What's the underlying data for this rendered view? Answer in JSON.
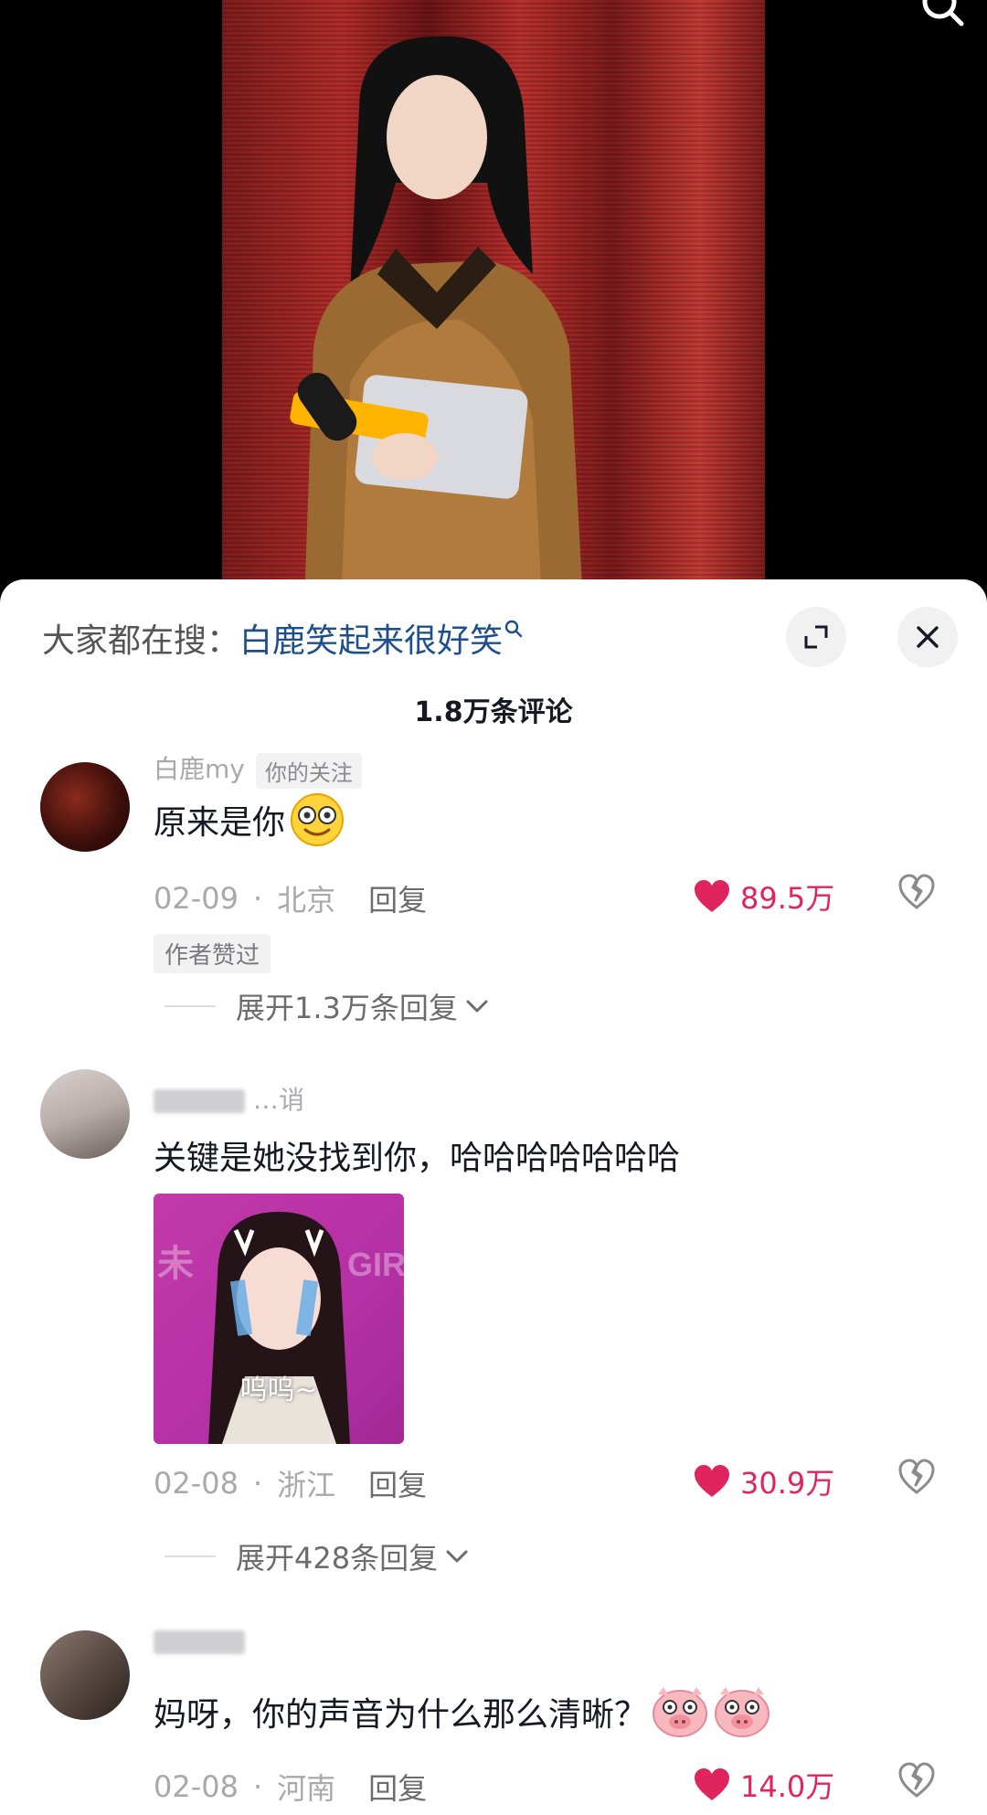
{
  "sheet": {
    "hot_search_prefix": "大家都在搜：",
    "hot_search_term": "白鹿笑起来很好笑",
    "comment_count": "1.8万条评论"
  },
  "comments": [
    {
      "username": "白鹿my",
      "follow_tag": "你的关注",
      "text": "原来是你",
      "date": "02-09",
      "location": "北京",
      "reply_label": "回复",
      "likes": "89.5万",
      "author_liked": "作者赞过",
      "expand_label": "展开1.3万条回复"
    },
    {
      "username": "…诮",
      "text": "关键是她没找到你，哈哈哈哈哈哈哈",
      "sticker_caption": "呜呜~",
      "sticker_bg_text": "未 GIR",
      "date": "02-08",
      "location": "浙江",
      "reply_label": "回复",
      "likes": "30.9万",
      "expand_label": "展开428条回复"
    },
    {
      "text": "妈呀，你的声音为什么那么清晰？",
      "date": "02-08",
      "location": "河南",
      "reply_label": "回复",
      "likes": "14.0万"
    }
  ],
  "icons": {
    "search": "search-icon",
    "expand": "expand-icon",
    "close": "close-icon",
    "like": "heart-icon",
    "dislike": "broken-heart-icon",
    "chevron": "chevron-down-icon"
  },
  "colors": {
    "like_red": "#e0245e",
    "link_blue": "#1e4f8c"
  }
}
